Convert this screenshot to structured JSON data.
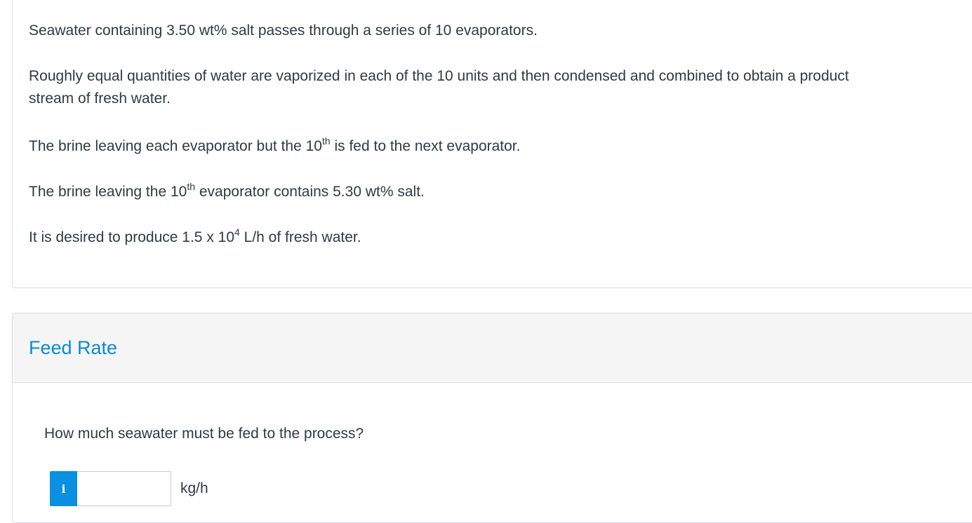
{
  "problem": {
    "p1": "Seawater containing 3.50 wt% salt passes through a series of 10 evaporators.",
    "p2_line1": "Roughly equal quantities of water are vaporized in each of the 10 units and then condensed and combined to obtain a product",
    "p2_line2": "stream of fresh water.",
    "p3_pre": "The brine leaving each evaporator but the 10",
    "p3_sup": "th",
    "p3_post": " is fed to the next evaporator.",
    "p4_pre": "The brine leaving the 10",
    "p4_sup": "th",
    "p4_post": " evaporator contains 5.30 wt% salt.",
    "p5_pre": "It is desired to produce 1.5 x 10",
    "p5_sup": "4",
    "p5_post": " L/h of fresh water."
  },
  "part": {
    "title": "Feed Rate",
    "question": "How much seawater must be fed to the process?",
    "info_icon": "i",
    "answer_value": "",
    "unit": "kg/h"
  },
  "colors": {
    "title_blue": "#0a8ad6",
    "info_button": "#0b8fe0",
    "header_bg": "#f5f5f5"
  }
}
